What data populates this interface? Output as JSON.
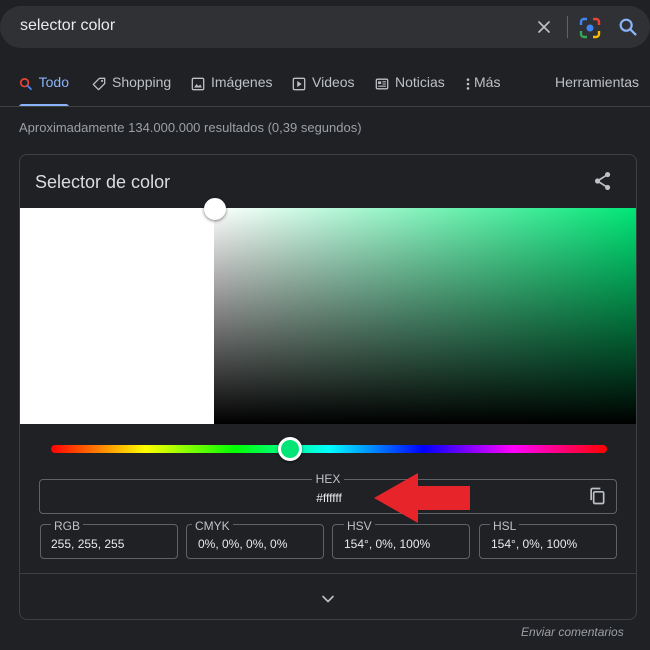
{
  "search": {
    "query": "selector color",
    "clear_icon": "close-icon",
    "lens_icon": "google-lens-icon",
    "search_icon": "search-icon"
  },
  "tabs": [
    {
      "label": "Todo",
      "icon": "search-icon",
      "active": true
    },
    {
      "label": "Shopping",
      "icon": "tag-icon"
    },
    {
      "label": "Imágenes",
      "icon": "image-icon"
    },
    {
      "label": "Videos",
      "icon": "play-icon"
    },
    {
      "label": "Noticias",
      "icon": "news-icon"
    },
    {
      "label": "Más",
      "icon": "more-vert-icon"
    }
  ],
  "tools_label": "Herramientas",
  "result_stats": "Aproximadamente 134.000.000 resultados (0,39 segundos)",
  "picker": {
    "title": "Selector de color",
    "share_icon": "share-icon",
    "hue_level": 0.43,
    "hue_color": "#00e676",
    "selected_color": "#ffffff",
    "hex_label": "HEX",
    "hex_value": "#ffffff",
    "copy_icon": "copy-icon",
    "values": [
      {
        "label": "RGB",
        "value": "255, 255, 255"
      },
      {
        "label": "CMYK",
        "value": "0%, 0%, 0%, 0%"
      },
      {
        "label": "HSV",
        "value": "154°, 0%, 100%"
      },
      {
        "label": "HSL",
        "value": "154°, 0%, 100%"
      }
    ],
    "expand_icon": "chevron-down-icon"
  },
  "annotation_color": "#e8242b",
  "feedback_label": "Enviar comentarios"
}
